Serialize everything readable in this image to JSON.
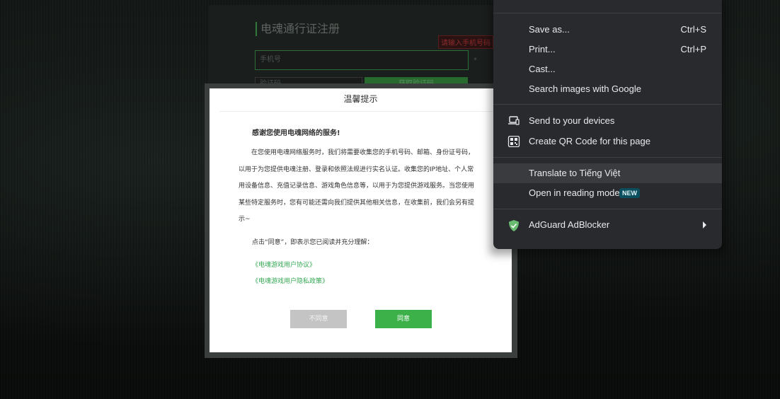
{
  "registration": {
    "title": "电魂通行证注册",
    "error_tip": "请输入手机号码",
    "phone_placeholder": "手机号",
    "required_mark": "*",
    "code_placeholder": "验证码",
    "get_code_label": "获取验证码"
  },
  "dialog": {
    "title": "温馨提示",
    "greeting": "感谢您使用电魂网络的服务!",
    "body": "在您使用电魂网络服务时，我们将需要收集您的手机号码、邮箱、身份证号码，以用于为您提供电魂注册、登录和依照法规进行实名认证。收集您的IP地址、个人常用设备信息、充值记录信息、游戏角色信息等，以用于为您提供游戏服务。当您使用某些特定服务时，您有可能还需向我们提供其他相关信息，在收集前，我们会另有提示~",
    "note": "点击“同意”，即表示您已阅读并充分理解：",
    "links": {
      "user_agreement": "《电魂游戏用户协议》",
      "privacy_policy": "《电魂游戏用户隐私政策》"
    },
    "buttons": {
      "disagree": "不同意",
      "agree": "同意"
    }
  },
  "context_menu": {
    "items": {
      "save_as": {
        "label": "Save as...",
        "shortcut": "Ctrl+S"
      },
      "print": {
        "label": "Print...",
        "shortcut": "Ctrl+P"
      },
      "cast": {
        "label": "Cast..."
      },
      "search_images": {
        "label": "Search images with Google"
      },
      "send_devices": {
        "label": "Send to your devices",
        "icon": "devices-icon"
      },
      "qr_code": {
        "label": "Create QR Code for this page",
        "icon": "qr-code-icon"
      },
      "translate": {
        "label": "Translate to Tiếng Việt"
      },
      "reading_mode": {
        "label": "Open in reading mode",
        "badge": "NEW"
      },
      "adguard": {
        "label": "AdGuard AdBlocker",
        "icon": "adguard-shield-icon"
      }
    },
    "colors": {
      "background": "#292a2d",
      "highlight": "#3a3b3e",
      "badge": "#0b4f5e",
      "adguard_green": "#68bc71"
    }
  },
  "colors": {
    "agree_button": "#3cb14a",
    "disagree_button": "#c4c4c4",
    "link": "#34a853"
  }
}
